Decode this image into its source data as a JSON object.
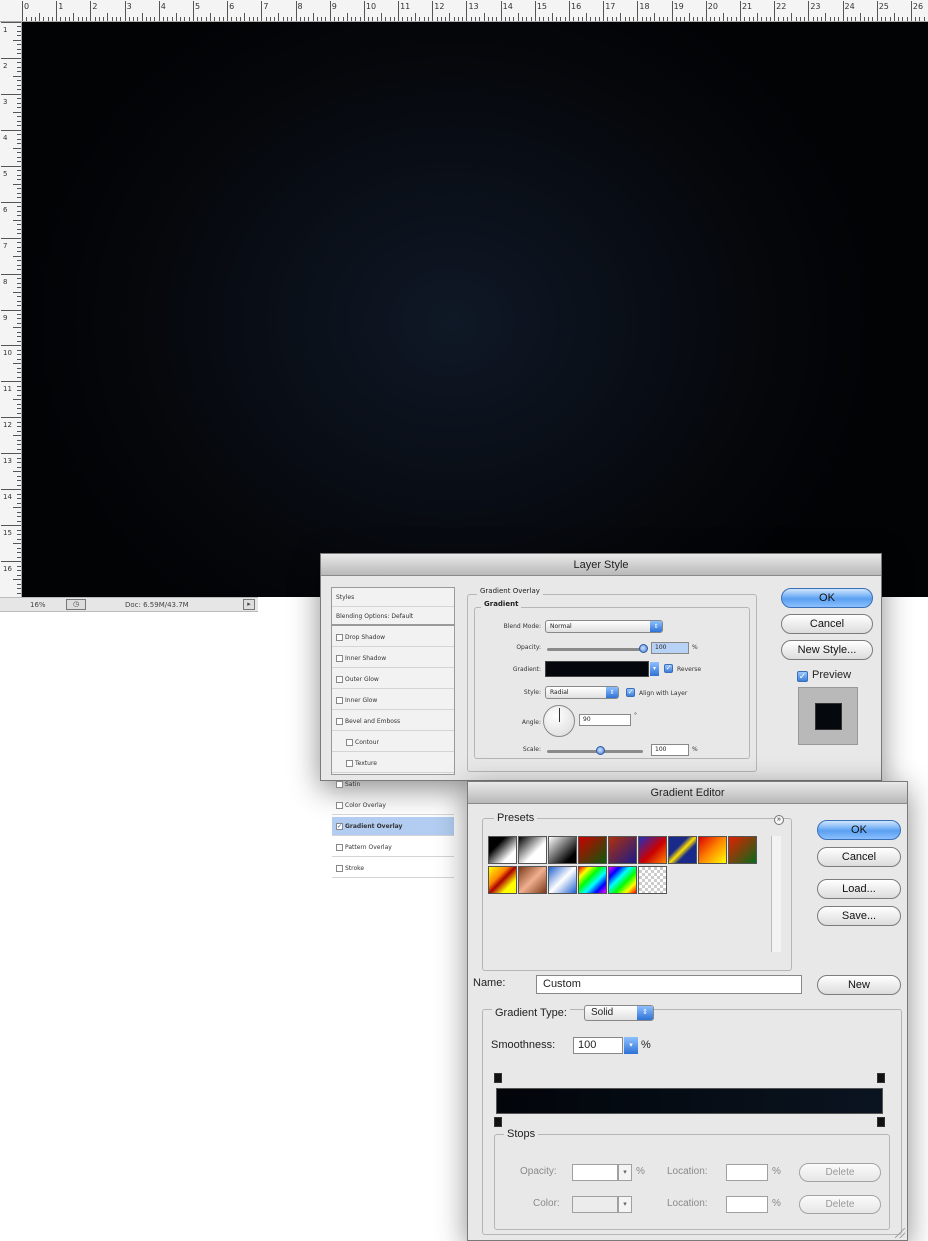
{
  "ruler": {
    "top_labels": [
      "0",
      "1",
      "2",
      "3",
      "4",
      "5",
      "6",
      "7",
      "8",
      "9",
      "10",
      "11",
      "12",
      "13",
      "14",
      "15",
      "16",
      "17",
      "18",
      "19",
      "20",
      "21",
      "22",
      "23",
      "24",
      "25",
      "26"
    ],
    "left_labels": [
      "1",
      "2",
      "3",
      "4",
      "5",
      "6",
      "7",
      "8",
      "9",
      "10",
      "11",
      "12",
      "13",
      "14",
      "15",
      "16"
    ]
  },
  "status": {
    "zoom": "16%",
    "doc_size": "Doc: 6.59M/43.7M"
  },
  "layer_style": {
    "title": "Layer Style",
    "styles_header": "Styles",
    "blending_options": "Blending Options: Default",
    "items": [
      {
        "label": "Drop Shadow",
        "checked": false,
        "indent": false
      },
      {
        "label": "Inner Shadow",
        "checked": false,
        "indent": false
      },
      {
        "label": "Outer Glow",
        "checked": false,
        "indent": false
      },
      {
        "label": "Inner Glow",
        "checked": false,
        "indent": false
      },
      {
        "label": "Bevel and Emboss",
        "checked": false,
        "indent": false
      },
      {
        "label": "Contour",
        "checked": false,
        "indent": true
      },
      {
        "label": "Texture",
        "checked": false,
        "indent": true
      },
      {
        "label": "Satin",
        "checked": false,
        "indent": false
      },
      {
        "label": "Color Overlay",
        "checked": false,
        "indent": false
      },
      {
        "label": "Gradient Overlay",
        "checked": true,
        "indent": false
      },
      {
        "label": "Pattern Overlay",
        "checked": false,
        "indent": false
      },
      {
        "label": "Stroke",
        "checked": false,
        "indent": false
      }
    ],
    "section_title": "Gradient Overlay",
    "group_title": "Gradient",
    "blend_mode_label": "Blend Mode:",
    "blend_mode_value": "Normal",
    "opacity_label": "Opacity:",
    "opacity_value": "100",
    "percent_sign": "%",
    "gradient_label": "Gradient:",
    "reverse_label": "Reverse",
    "style_label": "Style:",
    "style_value": "Radial",
    "align_label": "Align with Layer",
    "angle_label": "Angle:",
    "angle_value": "90",
    "degree_sign": "°",
    "scale_label": "Scale:",
    "scale_value": "100",
    "scale_fraction": 0.55,
    "ok_label": "OK",
    "cancel_label": "Cancel",
    "new_style_label": "New Style...",
    "preview_label": "Preview"
  },
  "gradient_editor": {
    "title": "Gradient Editor",
    "presets_title": "Presets",
    "menu_icon": "arrow-circle-icon",
    "ok_label": "OK",
    "cancel_label": "Cancel",
    "load_label": "Load...",
    "save_label": "Save...",
    "name_label": "Name:",
    "name_value": "Custom",
    "new_label": "New",
    "gradient_type_label": "Gradient Type:",
    "gradient_type_value": "Solid",
    "smoothness_label": "Smoothness:",
    "smoothness_value": "100",
    "percent_sign": "%",
    "stops_title": "Stops",
    "opacity_label": "Opacity:",
    "color_label": "Color:",
    "location_label": "Location:",
    "delete_label": "Delete",
    "gradient_colors": [
      "#02050a",
      "#0a1420"
    ]
  },
  "colors": {
    "canvas_center": "#0f1826",
    "canvas_edge": "#020305",
    "accent": "#3c7ed8"
  }
}
